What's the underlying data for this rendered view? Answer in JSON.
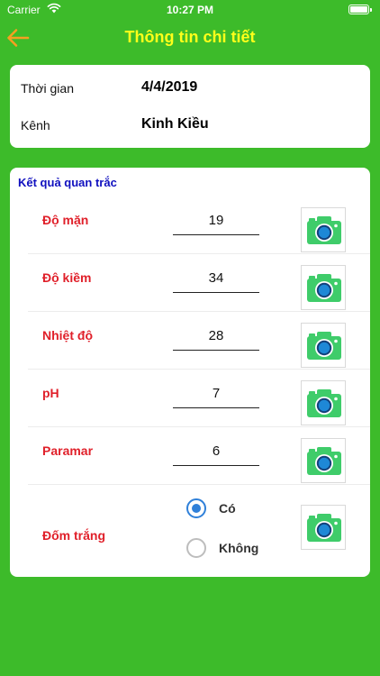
{
  "status": {
    "carrier": "Carrier",
    "time": "10:27 PM"
  },
  "nav": {
    "title": "Thông tin chi tiết"
  },
  "info": {
    "time_label": "Thời gian",
    "time_value": "4/4/2019",
    "channel_label": "Kênh",
    "channel_value": "Kinh Kiều"
  },
  "results": {
    "title": "Kết quả quan trắc",
    "rows": [
      {
        "label": "Độ mặn",
        "value": "19"
      },
      {
        "label": "Độ kiềm",
        "value": "34"
      },
      {
        "label": "Nhiệt độ",
        "value": "28"
      },
      {
        "label": "pH",
        "value": "7"
      },
      {
        "label": "Paramar",
        "value": "6"
      }
    ],
    "white_spot": {
      "label": "Đốm trắng",
      "options": [
        {
          "label": "Có",
          "checked": true
        },
        {
          "label": "Không",
          "checked": false
        }
      ]
    }
  },
  "colors": {
    "background": "#3dbb2a",
    "title": "#ffff1a",
    "back_arrow": "#f5a020",
    "section_title": "#1010bf",
    "label_red": "#e0202a",
    "radio_selected": "#2f80d9",
    "camera": "#3fcc6a"
  },
  "icons": {
    "back": "arrow-left-icon",
    "camera": "camera-icon",
    "wifi": "wifi-icon",
    "battery": "battery-icon"
  }
}
